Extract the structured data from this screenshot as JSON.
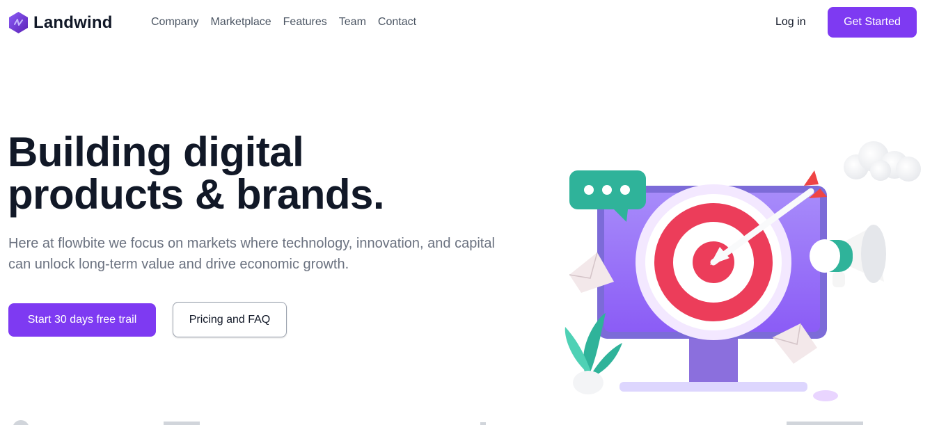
{
  "brand": {
    "name": "Landwind",
    "logo_icon": "hexagon-logo-icon"
  },
  "nav": {
    "items": [
      {
        "label": "Company"
      },
      {
        "label": "Marketplace"
      },
      {
        "label": "Features"
      },
      {
        "label": "Team"
      },
      {
        "label": "Contact"
      }
    ],
    "login_label": "Log in",
    "cta_label": "Get Started"
  },
  "hero": {
    "title_line1": "Building digital",
    "title_line2": "products & brands.",
    "description": "Here at flowbite we focus on markets where technology, innovation, and capital can unlock long-term value and drive economic growth.",
    "primary_button": "Start 30 days free trail",
    "secondary_button": "Pricing and FAQ",
    "illustration": "target-monitor-illustration"
  },
  "colors": {
    "accent": "#7e3af2",
    "text_dark": "#111827",
    "text_muted": "#6b7280",
    "nav_text": "#4b5563"
  }
}
